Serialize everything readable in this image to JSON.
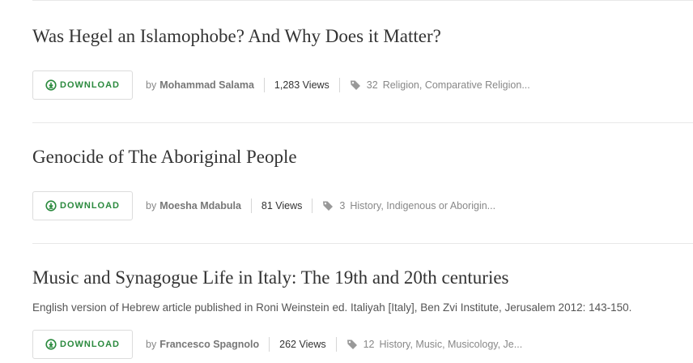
{
  "colors": {
    "accent": "#2b8a3e",
    "muted": "#888888",
    "text": "#333333",
    "divider": "#e8e8e8"
  },
  "icons": {
    "download": "download-circle-icon",
    "tag": "tag-icon"
  },
  "works": [
    {
      "title": "Was Hegel an Islamophobe? And Why Does it Matter?",
      "abstract": "",
      "download_label": "DOWNLOAD",
      "by": "by",
      "author": "Mohammad Salama",
      "views": "1,283 Views",
      "tag_count": "32",
      "tags": "Religion, Comparative Religion..."
    },
    {
      "title": "Genocide of The Aboriginal People",
      "abstract": "",
      "download_label": "DOWNLOAD",
      "by": "by",
      "author": "Moesha Mdabula",
      "views": "81 Views",
      "tag_count": "3",
      "tags": "History, Indigenous or Aborigin..."
    },
    {
      "title": "Music and Synagogue Life in Italy: The 19th and 20th centuries",
      "abstract": "English version of Hebrew article published in Roni Weinstein ed. Italiyah [Italy], Ben Zvi Institute, Jerusalem 2012: 143-150.",
      "download_label": "DOWNLOAD",
      "by": "by",
      "author": "Francesco Spagnolo",
      "views": "262 Views",
      "tag_count": "12",
      "tags": "History, Music, Musicology, Je..."
    }
  ]
}
